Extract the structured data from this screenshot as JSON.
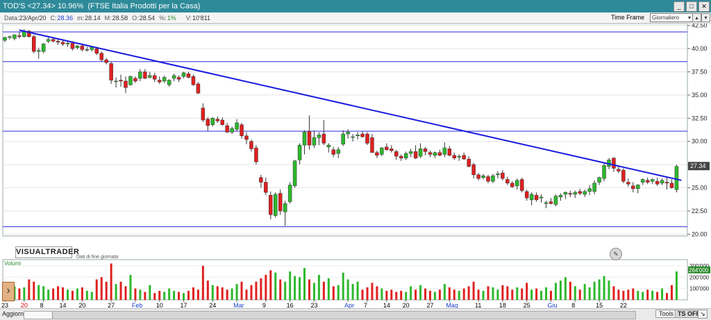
{
  "window": {
    "title": "TOD'S <27.34> 10.96%  (FTSE Italia Prodotti per la Casa)"
  },
  "infobar": {
    "data_label": "Data:",
    "data_value": "23/Apr/20",
    "c_label": "C:",
    "c_value": "28.36",
    "m_label": "m:",
    "m_value": "28.14",
    "M_label": "M:",
    "M_value": "28.58",
    "o_label": "O:",
    "o_value": "28.54",
    "pct_label": "%:",
    "pct_value": "1%",
    "v_label": "V:",
    "v_value": "10'811",
    "timeframe_label": "Time Frame",
    "timeframe_value": "Giornaliero"
  },
  "branding": {
    "logo": "VISUALTRADER",
    "subtitle": "Dati di fine giornata"
  },
  "volume_label": "Volumi",
  "status": {
    "aggiorna": "Aggiorna",
    "tools": "Tools",
    "ts_off": "TS OFF"
  },
  "colors": {
    "up": "#2db82d",
    "down": "#e02020",
    "trend": "#1a1adf",
    "hline": "#2a2ae0"
  },
  "chart_data": {
    "type": "candlestick",
    "price_axis": {
      "labels": [
        "42.50",
        "40.00",
        "37.50",
        "35.00",
        "32.50",
        "30.00",
        "27.50",
        "25.00",
        "22.50",
        "20.00"
      ],
      "ylim": [
        19.8,
        42.7
      ]
    },
    "volume_axis": {
      "labels": [
        "300'000",
        "200'000",
        "100'000"
      ],
      "ylim": [
        0,
        330000
      ]
    },
    "last_price_tag": "27.34",
    "volume_last_tag": "264'000",
    "x_labels": [
      {
        "i": 0,
        "t": "23",
        "c": "#000"
      },
      {
        "i": 4,
        "t": "20",
        "c": "#d00"
      },
      {
        "i": 8,
        "t": "8",
        "c": "#000"
      },
      {
        "i": 12,
        "t": "14",
        "c": "#000"
      },
      {
        "i": 16,
        "t": "20",
        "c": "#000"
      },
      {
        "i": 22,
        "t": "27",
        "c": "#000"
      },
      {
        "i": 27,
        "t": "Feb",
        "c": "#1a3fcf"
      },
      {
        "i": 32,
        "t": "10",
        "c": "#000"
      },
      {
        "i": 37,
        "t": "17",
        "c": "#000"
      },
      {
        "i": 43,
        "t": "24",
        "c": "#000"
      },
      {
        "i": 48,
        "t": "Mar",
        "c": "#1a3fcf"
      },
      {
        "i": 54,
        "t": "9",
        "c": "#000"
      },
      {
        "i": 59,
        "t": "16",
        "c": "#000"
      },
      {
        "i": 64,
        "t": "23",
        "c": "#000"
      },
      {
        "i": 71,
        "t": "Apr",
        "c": "#1a3fcf"
      },
      {
        "i": 75,
        "t": "7",
        "c": "#000"
      },
      {
        "i": 79,
        "t": "14",
        "c": "#000"
      },
      {
        "i": 83,
        "t": "20",
        "c": "#000"
      },
      {
        "i": 88,
        "t": "27",
        "c": "#000"
      },
      {
        "i": 92,
        "t": "Mag",
        "c": "#1a3fcf"
      },
      {
        "i": 98,
        "t": "11",
        "c": "#000"
      },
      {
        "i": 103,
        "t": "18",
        "c": "#000"
      },
      {
        "i": 108,
        "t": "25",
        "c": "#000"
      },
      {
        "i": 113,
        "t": "Giu",
        "c": "#1a3fcf"
      },
      {
        "i": 118,
        "t": "8",
        "c": "#000"
      },
      {
        "i": 123,
        "t": "15",
        "c": "#000"
      },
      {
        "i": 128,
        "t": "22",
        "c": "#000"
      }
    ],
    "hlines": [
      41.8,
      38.6,
      31.1,
      20.8
    ],
    "trendline": {
      "start": [
        3,
        42.0
      ],
      "end": [
        140,
        25.8
      ]
    },
    "candles": [
      [
        40.9,
        41.3,
        40.7,
        41.2,
        150000
      ],
      [
        41.2,
        41.4,
        41.0,
        41.3,
        80000
      ],
      [
        41.1,
        41.5,
        40.9,
        41.5,
        120000
      ],
      [
        41.4,
        41.8,
        41.1,
        41.3,
        100000
      ],
      [
        41.3,
        42.1,
        41.2,
        41.9,
        110000
      ],
      [
        41.9,
        42.0,
        41.2,
        41.3,
        180000
      ],
      [
        41.3,
        41.5,
        39.5,
        39.7,
        160000
      ],
      [
        39.7,
        40.1,
        38.9,
        39.8,
        130000
      ],
      [
        39.7,
        40.6,
        39.5,
        40.5,
        120000
      ],
      [
        40.8,
        41.2,
        40.6,
        41.0,
        90000
      ],
      [
        41.0,
        41.2,
        40.7,
        40.8,
        100000
      ],
      [
        40.8,
        41.0,
        40.4,
        40.7,
        120000
      ],
      [
        40.7,
        41.0,
        40.3,
        40.5,
        110000
      ],
      [
        40.5,
        40.8,
        40.2,
        40.6,
        90000
      ],
      [
        40.6,
        40.8,
        39.8,
        40.0,
        80000
      ],
      [
        40.1,
        40.4,
        39.9,
        40.3,
        100000
      ],
      [
        40.3,
        40.5,
        39.7,
        39.9,
        110000
      ],
      [
        39.9,
        40.2,
        39.7,
        39.9,
        80000
      ],
      [
        39.9,
        40.3,
        39.7,
        40.2,
        70000
      ],
      [
        40.0,
        40.2,
        39.3,
        39.5,
        180000
      ],
      [
        39.5,
        39.7,
        38.6,
        38.8,
        200000
      ],
      [
        38.8,
        39.0,
        38.3,
        38.5,
        160000
      ],
      [
        38.4,
        38.6,
        36.2,
        36.6,
        320000
      ],
      [
        36.5,
        36.9,
        35.8,
        36.5,
        140000
      ],
      [
        36.6,
        37.2,
        35.9,
        36.5,
        160000
      ],
      [
        36.5,
        37.0,
        35.2,
        35.8,
        120000
      ],
      [
        36.1,
        37.1,
        36.0,
        37.0,
        220000
      ],
      [
        36.8,
        37.0,
        36.3,
        36.5,
        100000
      ],
      [
        36.8,
        37.8,
        36.5,
        37.5,
        90000
      ],
      [
        37.5,
        37.8,
        36.7,
        36.8,
        70000
      ],
      [
        36.9,
        37.5,
        36.8,
        37.1,
        130000
      ],
      [
        37.1,
        37.4,
        36.4,
        36.7,
        60000
      ],
      [
        36.6,
        37.0,
        36.2,
        36.4,
        80000
      ],
      [
        36.5,
        37.1,
        36.3,
        36.9,
        70000
      ],
      [
        36.1,
        36.7,
        35.9,
        36.6,
        100000
      ],
      [
        36.8,
        37.3,
        36.5,
        37.1,
        80000
      ],
      [
        36.9,
        37.1,
        36.4,
        36.7,
        70000
      ],
      [
        37.0,
        37.5,
        36.8,
        37.4,
        60000
      ],
      [
        37.3,
        37.5,
        36.8,
        36.9,
        80000
      ],
      [
        37.0,
        37.2,
        36.0,
        36.1,
        110000
      ],
      [
        36.2,
        36.4,
        35.1,
        35.2,
        90000
      ],
      [
        33.6,
        34.1,
        32.1,
        32.3,
        300000
      ],
      [
        32.4,
        32.6,
        31.1,
        31.7,
        170000
      ],
      [
        31.8,
        32.6,
        31.6,
        32.5,
        130000
      ],
      [
        32.4,
        32.7,
        32.0,
        32.2,
        120000
      ],
      [
        32.3,
        32.6,
        31.7,
        31.8,
        110000
      ],
      [
        31.7,
        32.0,
        30.9,
        31.0,
        90000
      ],
      [
        31.0,
        31.6,
        30.8,
        31.4,
        100000
      ],
      [
        31.3,
        32.4,
        31.1,
        32.0,
        140000
      ],
      [
        31.8,
        32.0,
        30.3,
        30.6,
        160000
      ],
      [
        30.6,
        31.0,
        29.7,
        30.2,
        90000
      ],
      [
        30.0,
        30.2,
        28.9,
        29.2,
        130000
      ],
      [
        29.3,
        29.6,
        27.5,
        27.8,
        160000
      ],
      [
        26.1,
        26.4,
        25.0,
        25.6,
        190000
      ],
      [
        25.6,
        26.1,
        24.2,
        24.5,
        220000
      ],
      [
        24.2,
        24.6,
        21.6,
        22.1,
        260000
      ],
      [
        22.0,
        24.5,
        21.8,
        24.3,
        240000
      ],
      [
        24.4,
        24.8,
        22.1,
        22.5,
        180000
      ],
      [
        22.4,
        23.6,
        20.9,
        23.3,
        160000
      ],
      [
        23.5,
        25.6,
        23.3,
        25.3,
        250000
      ],
      [
        25.2,
        28.0,
        25.0,
        27.9,
        210000
      ],
      [
        28.0,
        29.8,
        27.5,
        29.6,
        200000
      ],
      [
        29.6,
        31.2,
        28.6,
        31.0,
        280000
      ],
      [
        31.1,
        32.8,
        29.1,
        29.6,
        180000
      ],
      [
        29.6,
        31.2,
        29.3,
        30.4,
        150000
      ],
      [
        30.4,
        31.0,
        29.6,
        30.7,
        220000
      ],
      [
        30.8,
        32.3,
        29.6,
        29.8,
        160000
      ],
      [
        29.4,
        29.8,
        28.8,
        29.6,
        190000
      ],
      [
        29.1,
        29.4,
        28.3,
        28.6,
        120000
      ],
      [
        28.7,
        29.4,
        28.2,
        29.1,
        130000
      ],
      [
        29.7,
        31.2,
        29.5,
        30.8,
        240000
      ],
      [
        30.8,
        31.3,
        30.3,
        31.0,
        180000
      ],
      [
        30.5,
        30.8,
        30.0,
        30.5,
        140000
      ],
      [
        30.6,
        31.0,
        30.2,
        30.7,
        160000
      ],
      [
        30.8,
        31.1,
        30.4,
        30.5,
        90000
      ],
      [
        30.8,
        31.0,
        29.6,
        29.8,
        110000
      ],
      [
        30.4,
        30.8,
        29.2,
        28.8,
        150000
      ],
      [
        28.8,
        29.0,
        28.2,
        28.5,
        120000
      ],
      [
        28.6,
        29.4,
        28.4,
        29.3,
        100000
      ],
      [
        29.4,
        29.8,
        29.0,
        29.1,
        80000
      ],
      [
        29.2,
        29.6,
        28.8,
        29.0,
        90000
      ],
      [
        28.9,
        29.1,
        28.0,
        28.4,
        70000
      ],
      [
        28.4,
        28.6,
        27.9,
        28.2,
        80000
      ],
      [
        28.2,
        28.9,
        28.0,
        28.7,
        70000
      ],
      [
        28.7,
        29.2,
        28.3,
        28.9,
        120000
      ],
      [
        28.9,
        29.6,
        28.1,
        28.2,
        90000
      ],
      [
        28.4,
        29.8,
        28.2,
        29.2,
        130000
      ],
      [
        29.2,
        29.4,
        28.5,
        28.9,
        100000
      ],
      [
        28.8,
        29.0,
        28.3,
        28.6,
        80000
      ],
      [
        28.5,
        28.9,
        28.2,
        28.8,
        70000
      ],
      [
        28.8,
        29.1,
        28.4,
        28.5,
        90000
      ],
      [
        28.6,
        29.9,
        28.3,
        29.3,
        140000
      ],
      [
        29.2,
        29.5,
        28.4,
        28.5,
        110000
      ],
      [
        28.5,
        28.8,
        28.0,
        28.2,
        90000
      ],
      [
        28.3,
        28.6,
        27.9,
        28.4,
        80000
      ],
      [
        28.5,
        28.8,
        28.0,
        28.1,
        100000
      ],
      [
        28.1,
        28.4,
        27.2,
        27.3,
        120000
      ],
      [
        27.5,
        27.7,
        26.0,
        26.4,
        160000
      ],
      [
        26.4,
        26.6,
        25.8,
        26.0,
        90000
      ],
      [
        26.1,
        26.5,
        25.9,
        26.3,
        80000
      ],
      [
        26.2,
        26.4,
        25.5,
        25.7,
        120000
      ],
      [
        25.7,
        26.5,
        25.5,
        26.3,
        110000
      ],
      [
        26.4,
        26.8,
        26.0,
        26.5,
        90000
      ],
      [
        26.6,
        26.9,
        25.8,
        26.0,
        130000
      ],
      [
        25.9,
        26.2,
        25.3,
        25.5,
        120000
      ],
      [
        25.5,
        25.7,
        25.0,
        25.1,
        90000
      ],
      [
        25.2,
        26.0,
        24.8,
        25.8,
        110000
      ],
      [
        25.9,
        26.1,
        24.5,
        24.7,
        100000
      ],
      [
        24.6,
        24.8,
        23.6,
        23.9,
        150000
      ],
      [
        23.7,
        24.5,
        23.1,
        24.3,
        90000
      ],
      [
        24.2,
        24.5,
        23.5,
        23.7,
        100000
      ],
      [
        23.9,
        24.3,
        23.4,
        24.0,
        80000
      ],
      [
        23.3,
        23.6,
        22.8,
        23.4,
        110000
      ],
      [
        23.5,
        23.9,
        23.2,
        23.3,
        80000
      ],
      [
        23.2,
        24.3,
        23.0,
        24.1,
        150000
      ],
      [
        24.0,
        24.4,
        23.6,
        24.2,
        170000
      ],
      [
        24.3,
        24.6,
        23.8,
        24.5,
        200000
      ],
      [
        24.4,
        24.7,
        24.0,
        24.3,
        160000
      ],
      [
        24.3,
        24.7,
        23.9,
        24.5,
        120000
      ],
      [
        24.6,
        24.9,
        24.2,
        24.4,
        90000
      ],
      [
        24.3,
        24.8,
        24.0,
        24.6,
        140000
      ],
      [
        24.6,
        25.3,
        24.2,
        24.9,
        110000
      ],
      [
        24.6,
        25.8,
        24.3,
        25.5,
        160000
      ],
      [
        25.6,
        26.2,
        25.3,
        26.1,
        180000
      ],
      [
        26.0,
        27.7,
        25.7,
        27.4,
        210000
      ],
      [
        27.3,
        28.2,
        27.0,
        28.0,
        170000
      ],
      [
        28.2,
        28.3,
        26.7,
        27.1,
        120000
      ],
      [
        27.0,
        27.4,
        26.6,
        26.8,
        90000
      ],
      [
        26.9,
        27.1,
        25.5,
        25.7,
        80000
      ],
      [
        25.6,
        26.0,
        25.1,
        25.4,
        90000
      ],
      [
        25.2,
        25.6,
        24.5,
        24.9,
        100000
      ],
      [
        24.9,
        25.4,
        24.4,
        25.3,
        80000
      ],
      [
        25.6,
        26.0,
        25.3,
        25.9,
        70000
      ],
      [
        25.8,
        26.1,
        25.4,
        25.6,
        90000
      ],
      [
        25.7,
        26.0,
        25.4,
        25.9,
        80000
      ],
      [
        25.7,
        26.1,
        25.2,
        25.4,
        70000
      ],
      [
        25.5,
        26.0,
        25.3,
        25.8,
        100000
      ],
      [
        25.6,
        26.2,
        24.8,
        25.5,
        60000
      ],
      [
        25.5,
        25.9,
        24.9,
        25.0,
        130000
      ],
      [
        24.8,
        27.5,
        24.5,
        27.3,
        250000
      ]
    ]
  }
}
